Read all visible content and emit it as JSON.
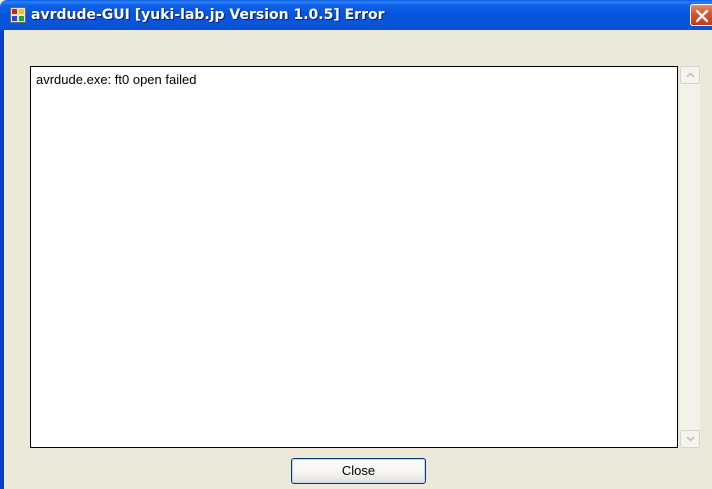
{
  "window": {
    "title": "avrdude-GUI [yuki-lab.jp Version 1.0.5] Error",
    "icon": "app-icon",
    "close_icon": "close-x-icon"
  },
  "output": {
    "text": "avrdude.exe: ft0 open failed"
  },
  "scrollbar": {
    "up_icon": "scroll-up-arrow-icon",
    "down_icon": "scroll-down-arrow-icon",
    "enabled": false
  },
  "buttons": {
    "close_label": "Close"
  },
  "colors": {
    "titlebar": "#0653DC",
    "background": "#ECE9D8",
    "close_button_red": "#D6522E"
  }
}
